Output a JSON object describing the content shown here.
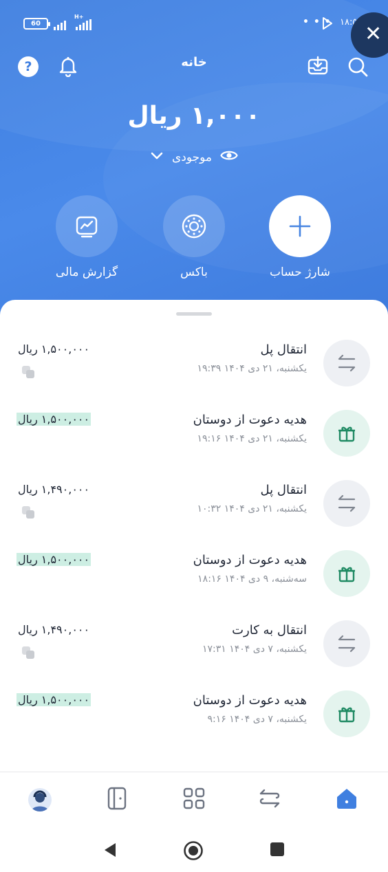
{
  "status_bar": {
    "battery": "60",
    "time": "۱۸:۵۱",
    "network_label": "H+",
    "dots": "• • •"
  },
  "topbar": {
    "title": "خانه"
  },
  "balance": {
    "amount": "۱,۰۰۰ ریال",
    "label": "موجودی"
  },
  "actions": [
    {
      "label": "شارژ حساب",
      "icon": "plus-icon"
    },
    {
      "label": "باکس",
      "icon": "box-icon"
    },
    {
      "label": "گزارش مالی",
      "icon": "chart-icon"
    }
  ],
  "transactions": [
    {
      "type": "transfer",
      "title": "انتقال پل",
      "date": "یکشنبه، ۲۱ دی ۱۴۰۴ ۱۹:۳۹",
      "amount": "۱,۵۰۰,۰۰۰ ریال"
    },
    {
      "type": "gift",
      "title": "هدیه دعوت از دوستان",
      "date": "یکشنبه، ۲۱ دی ۱۴۰۴ ۱۹:۱۶",
      "amount": "۱,۵۰۰,۰۰۰ ریال"
    },
    {
      "type": "transfer",
      "title": "انتقال پل",
      "date": "یکشنبه، ۲۱ دی ۱۴۰۴ ۱۰:۳۲",
      "amount": "۱,۴۹۰,۰۰۰ ریال"
    },
    {
      "type": "gift",
      "title": "هدیه دعوت از دوستان",
      "date": "سه‌شنبه، ۹ دی ۱۴۰۴ ۱۸:۱۶",
      "amount": "۱,۵۰۰,۰۰۰ ریال"
    },
    {
      "type": "transfer",
      "title": "انتقال به کارت",
      "date": "یکشنبه، ۷ دی ۱۴۰۴ ۱۷:۳۱",
      "amount": "۱,۴۹۰,۰۰۰ ریال"
    },
    {
      "type": "gift",
      "title": "هدیه دعوت از دوستان",
      "date": "یکشنبه، ۷ دی ۱۴۰۴ ۹:۱۶",
      "amount": "۱,۵۰۰,۰۰۰ ریال"
    }
  ],
  "colors": {
    "brand_blue": "#3f7fe0",
    "gift_green": "#1f8a63",
    "gift_highlight": "#cdeee3",
    "nav_active": "#3f7fe0"
  },
  "bottom_nav": [
    {
      "name": "profile",
      "icon": "avatar"
    },
    {
      "name": "cards",
      "icon": "card-icon"
    },
    {
      "name": "services",
      "icon": "grid-icon"
    },
    {
      "name": "transfer",
      "icon": "transfer-icon"
    },
    {
      "name": "home",
      "icon": "home-icon",
      "active": true
    }
  ]
}
